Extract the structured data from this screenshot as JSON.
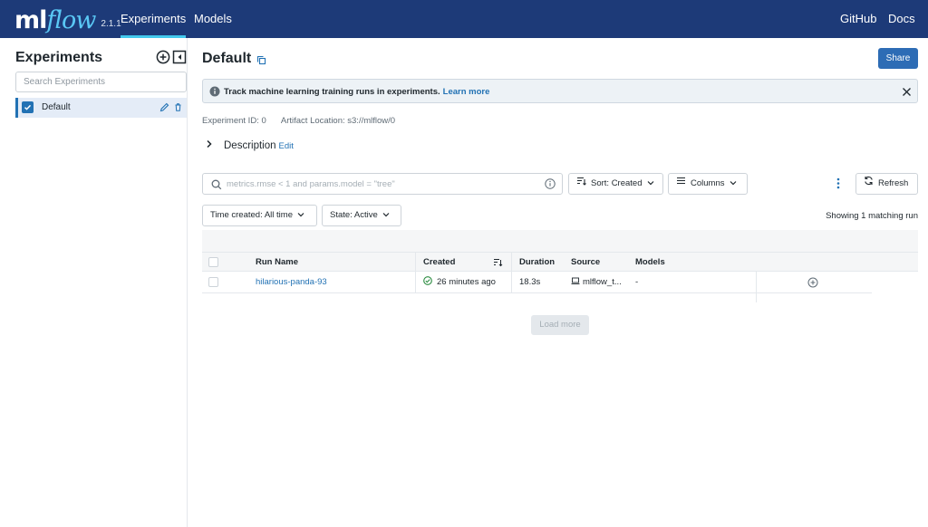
{
  "header": {
    "logo_ml": "ml",
    "logo_flow": "flow",
    "version": "2.1.1",
    "nav": [
      {
        "label": "Experiments",
        "active": true
      },
      {
        "label": "Models",
        "active": false
      }
    ],
    "right_links": [
      "GitHub",
      "Docs"
    ]
  },
  "sidebar": {
    "title": "Experiments",
    "search_placeholder": "Search Experiments",
    "experiments": [
      {
        "label": "Default",
        "checked": true
      }
    ]
  },
  "main": {
    "title": "Default",
    "share_label": "Share",
    "banner": {
      "text": "Track machine learning training runs in experiments.",
      "link": "Learn more"
    },
    "meta": {
      "experiment_id": "Experiment ID: 0",
      "artifact_location": "Artifact Location: s3://mlflow/0"
    },
    "description": {
      "label": "Description",
      "edit": "Edit"
    },
    "search_placeholder": "metrics.rmse < 1 and params.model = \"tree\"",
    "sort_label": "Sort: Created",
    "columns_label": "Columns",
    "refresh_label": "Refresh",
    "time_filter": "Time created: All time",
    "state_filter": "State: Active",
    "showing": "Showing 1 matching run",
    "table": {
      "headers": [
        "Run Name",
        "Created",
        "Duration",
        "Source",
        "Models"
      ],
      "rows": [
        {
          "run_name": "hilarious-panda-93",
          "created": "26 minutes ago",
          "duration": "18.3s",
          "source": "mlflow_t...",
          "models": "-"
        }
      ]
    },
    "load_more": "Load more"
  },
  "colors": {
    "header_bg": "#1d3a78",
    "accent": "#2272b4",
    "active_underline": "#43c9ed",
    "success": "#2a8b3f"
  }
}
